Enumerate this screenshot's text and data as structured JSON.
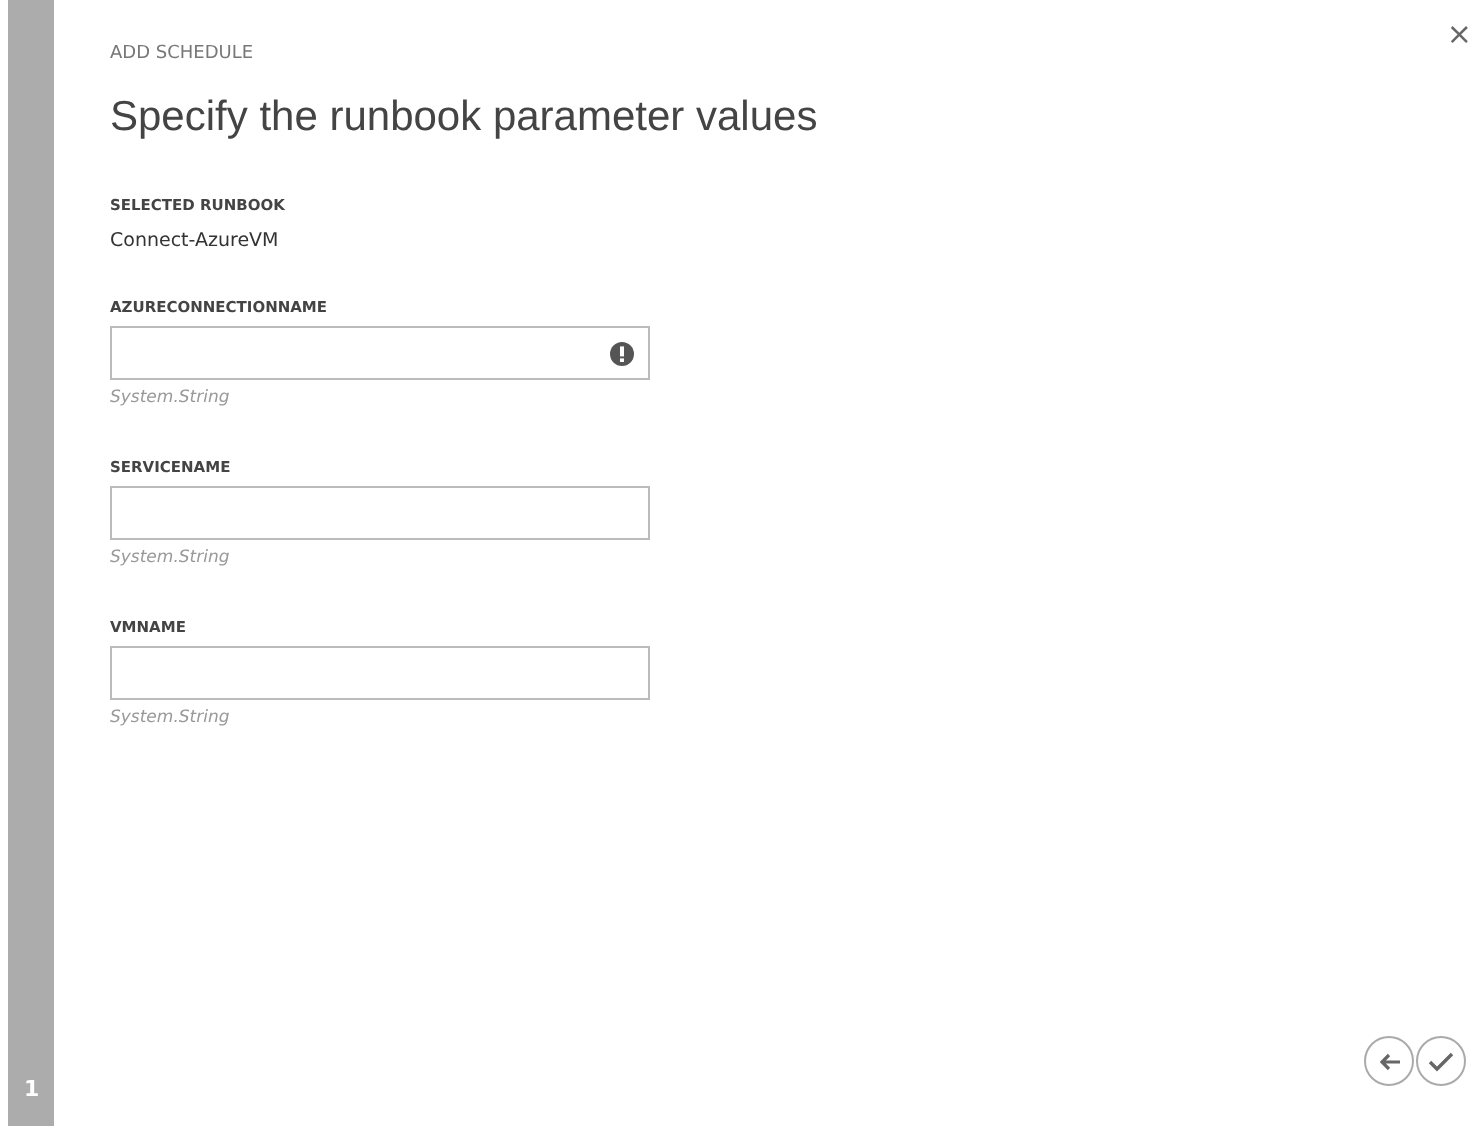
{
  "wizard": {
    "heading": "ADD SCHEDULE",
    "title": "Specify the runbook parameter values",
    "step": "1",
    "close": "×"
  },
  "selected_runbook": {
    "label": "SELECTED RUNBOOK",
    "value": "Connect-AzureVM"
  },
  "parameters": [
    {
      "label": "AZURECONNECTIONNAME",
      "type": "System.String",
      "error": true
    },
    {
      "label": "SERVICENAME",
      "type": "System.String",
      "error": false
    },
    {
      "label": "VMNAME",
      "type": "System.String",
      "error": false
    }
  ],
  "buttons": [
    {
      "kind": "back"
    },
    {
      "kind": "done"
    }
  ]
}
